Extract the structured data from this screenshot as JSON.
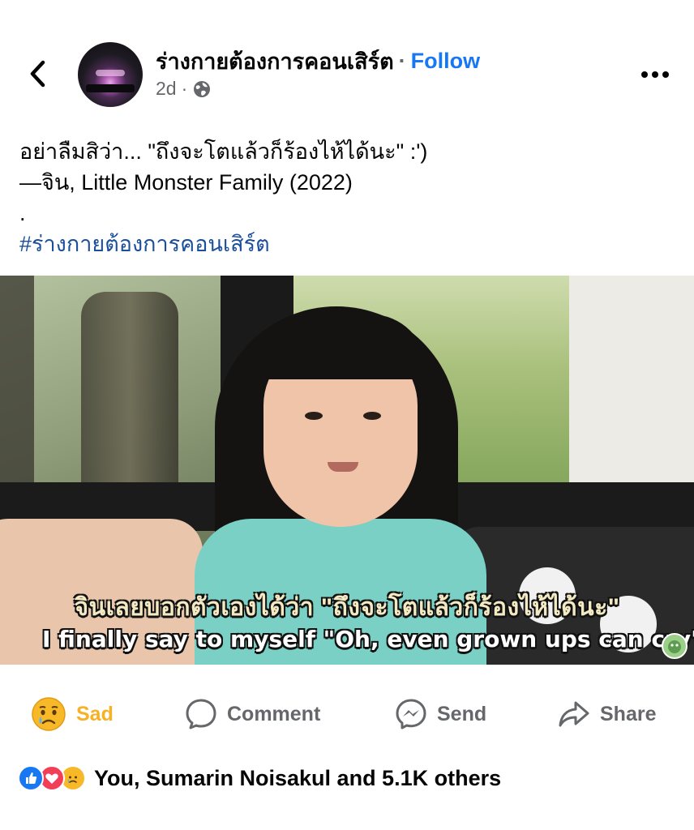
{
  "header": {
    "back_icon": "chevron-left-icon",
    "page_name": "ร่างกายต้องการคอนเสิร์ต",
    "separator": "·",
    "follow_label": "Follow",
    "timestamp": "2d",
    "meta_separator": "·",
    "privacy_icon": "globe-icon",
    "more_icon": "more-horizontal-icon"
  },
  "post": {
    "lines": [
      "อย่าลืมสิว่า... \"ถึงจะโตแล้วก็ร้องไห้ได้นะ\" :')",
      "—จิน, Little Monster Family (2022)",
      "."
    ],
    "hashtag": "#ร่างกายต้องการคอนเสิร์ต"
  },
  "media": {
    "subtitle_thai": "จินเลยบอกตัวเองได้ว่า \"ถึงจะโตแล้วก็ร้องไห้ได้นะ\"",
    "subtitle_english": "I finally say to myself \"Oh, even grown ups can cry\"",
    "logo_icon": "channel-logo-icon"
  },
  "actions": {
    "sad_label": "Sad",
    "comment_label": "Comment",
    "send_label": "Send",
    "share_label": "Share"
  },
  "reactions": {
    "icons": [
      "like-icon",
      "love-icon",
      "sad-icon"
    ],
    "summary": "You, Sumarin Noisakul and 5.1K others"
  },
  "colors": {
    "facebook_blue": "#1877f2",
    "hashtag_blue": "#1b4f9c",
    "muted_gray": "#65676b",
    "sad_yellow": "#f7b125"
  }
}
